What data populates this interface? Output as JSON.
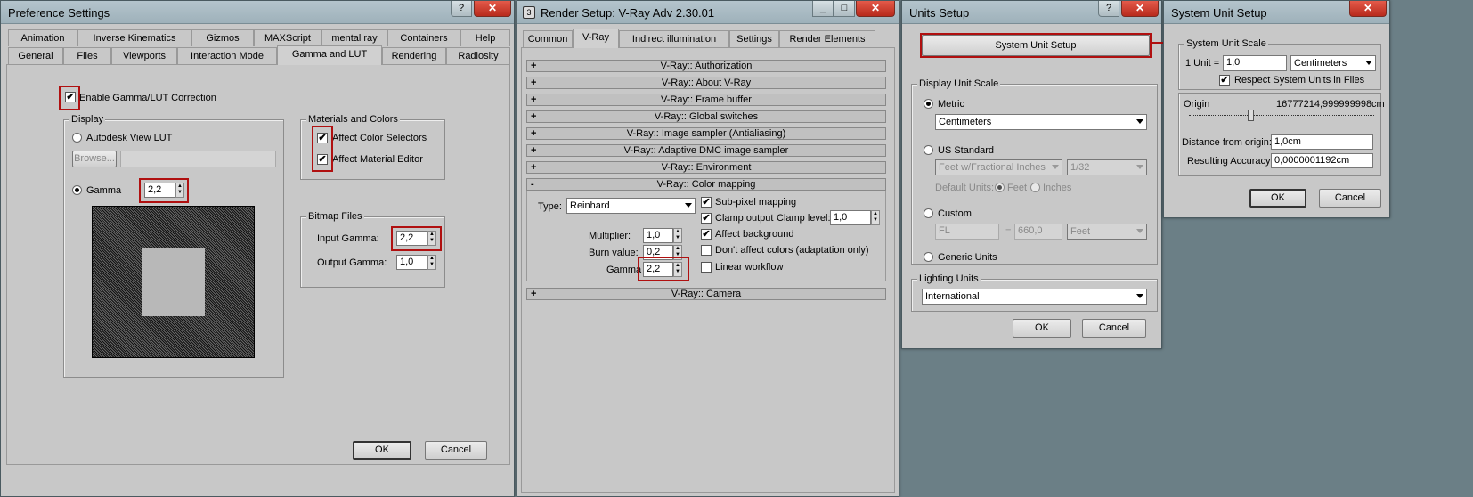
{
  "pref": {
    "title": "Preference Settings",
    "tabs_row1": [
      "Animation",
      "Inverse Kinematics",
      "Gizmos",
      "MAXScript",
      "mental ray",
      "Containers",
      "Help"
    ],
    "tabs_row2": [
      "General",
      "Files",
      "Viewports",
      "Interaction Mode",
      "Gamma and LUT",
      "Rendering",
      "Radiosity"
    ],
    "enable": "Enable Gamma/LUT Correction",
    "display": "Display",
    "autodesk": "Autodesk View LUT",
    "browse": "Browse...",
    "gamma": "Gamma",
    "gamma_val": "2,2",
    "mat": "Materials and Colors",
    "affect_color": "Affect Color Selectors",
    "affect_mat": "Affect Material Editor",
    "bitmap": "Bitmap Files",
    "input_gamma": "Input Gamma:",
    "input_val": "2,2",
    "output_gamma": "Output Gamma:",
    "output_val": "1,0",
    "ok": "OK",
    "cancel": "Cancel"
  },
  "render": {
    "title": "Render Setup: V-Ray Adv 2.30.01",
    "tabs": [
      "Common",
      "V-Ray",
      "Indirect illumination",
      "Settings",
      "Render Elements"
    ],
    "rollouts_top": [
      {
        "sign": "+",
        "label": "V-Ray:: Authorization"
      },
      {
        "sign": "+",
        "label": "V-Ray:: About V-Ray"
      },
      {
        "sign": "+",
        "label": "V-Ray:: Frame buffer"
      },
      {
        "sign": "+",
        "label": "V-Ray:: Global switches"
      },
      {
        "sign": "+",
        "label": "V-Ray:: Image sampler (Antialiasing)"
      },
      {
        "sign": "+",
        "label": "V-Ray:: Adaptive DMC image sampler"
      },
      {
        "sign": "+",
        "label": "V-Ray:: Environment"
      },
      {
        "sign": "-",
        "label": "V-Ray:: Color mapping"
      }
    ],
    "type_label": "Type:",
    "type_value": "Reinhard",
    "multiplier": "Multiplier:",
    "multiplier_val": "1,0",
    "burn": "Burn value:",
    "burn_val": "0,2",
    "gamma": "Gamma",
    "gamma_val": "2,2",
    "subpixel": "Sub-pixel mapping",
    "clamp": "Clamp output",
    "clamp_level": "Clamp level:",
    "clamp_val": "1,0",
    "affect_bg": "Affect background",
    "dont_affect": "Don't affect colors (adaptation only)",
    "linear": "Linear workflow",
    "camera": {
      "sign": "+",
      "label": "V-Ray:: Camera"
    }
  },
  "units": {
    "title": "Units Setup",
    "sys_button": "System Unit Setup",
    "display": "Display Unit Scale",
    "metric": "Metric",
    "metric_val": "Centimeters",
    "us": "US Standard",
    "us_val": "Feet w/Fractional Inches",
    "us_frac": "1/32",
    "default_units": "Default Units:",
    "feet": "Feet",
    "inches": "Inches",
    "custom": "Custom",
    "fl": "FL",
    "eq": "=",
    "custom_val": "660,0",
    "custom_unit": "Feet",
    "generic": "Generic Units",
    "lighting": "Lighting Units",
    "lighting_val": "International",
    "ok": "OK",
    "cancel": "Cancel"
  },
  "sysunit": {
    "title": "System Unit Setup",
    "scale": "System Unit Scale",
    "one_unit": "1 Unit =",
    "unit_val": "1,0",
    "unit_sel": "Centimeters",
    "respect": "Respect System Units in Files",
    "origin": "Origin",
    "origin_val": "16777214,999999998cm",
    "distance": "Distance from origin:",
    "distance_val": "1,0cm",
    "accuracy": "Resulting Accuracy:",
    "accuracy_val": "0,0000001192cm",
    "ok": "OK",
    "cancel": "Cancel"
  }
}
